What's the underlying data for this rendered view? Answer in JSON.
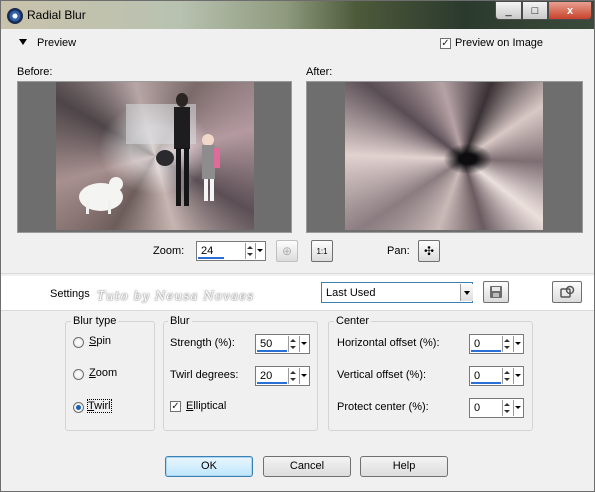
{
  "window": {
    "title": "Radial Blur",
    "minimize_glyph": "_",
    "maximize_glyph": "□",
    "close_glyph": "x"
  },
  "preview": {
    "section_label": "Preview",
    "preview_on_image_label": "Preview on Image",
    "preview_on_image_checked": true,
    "before_label": "Before:",
    "after_label": "After:",
    "zoom_label": "Zoom:",
    "zoom_value": "24",
    "pan_label": "Pan:",
    "one_to_one_glyph": "1:1",
    "fit_glyph": "⊕",
    "pan_glyph": "✣"
  },
  "settings": {
    "label": "Settings",
    "preset_value": "Last Used",
    "watermark": "Tuto by Neusa Novaes"
  },
  "blur_type": {
    "legend": "Blur type",
    "options": [
      {
        "label_first": "S",
        "label_rest": "pin",
        "selected": false
      },
      {
        "label_first": "Z",
        "label_rest": "oom",
        "selected": false
      },
      {
        "label_first": "T",
        "label_rest": "wirl",
        "selected": true
      }
    ]
  },
  "blur": {
    "legend": "Blur",
    "strength_label": "Strength (%):",
    "strength_value": "50",
    "strength_fraction": 0.5,
    "twirl_label": "Twirl degrees:",
    "twirl_value": "20",
    "elliptical_label": "Elliptical",
    "elliptical_checked": true
  },
  "center": {
    "legend": "Center",
    "horizontal_label": "Horizontal offset (%):",
    "horizontal_value": "0",
    "vertical_label": "Vertical offset (%):",
    "vertical_value": "0",
    "protect_label": "Protect center (%):",
    "protect_value": "0"
  },
  "buttons": {
    "ok": "OK",
    "cancel": "Cancel",
    "help": "Help"
  },
  "icons": [
    "app-icon",
    "collapse-arrow-icon",
    "fit-icon",
    "one-to-one-icon",
    "pan-icon",
    "save-preset-icon",
    "preset-manager-icon"
  ]
}
